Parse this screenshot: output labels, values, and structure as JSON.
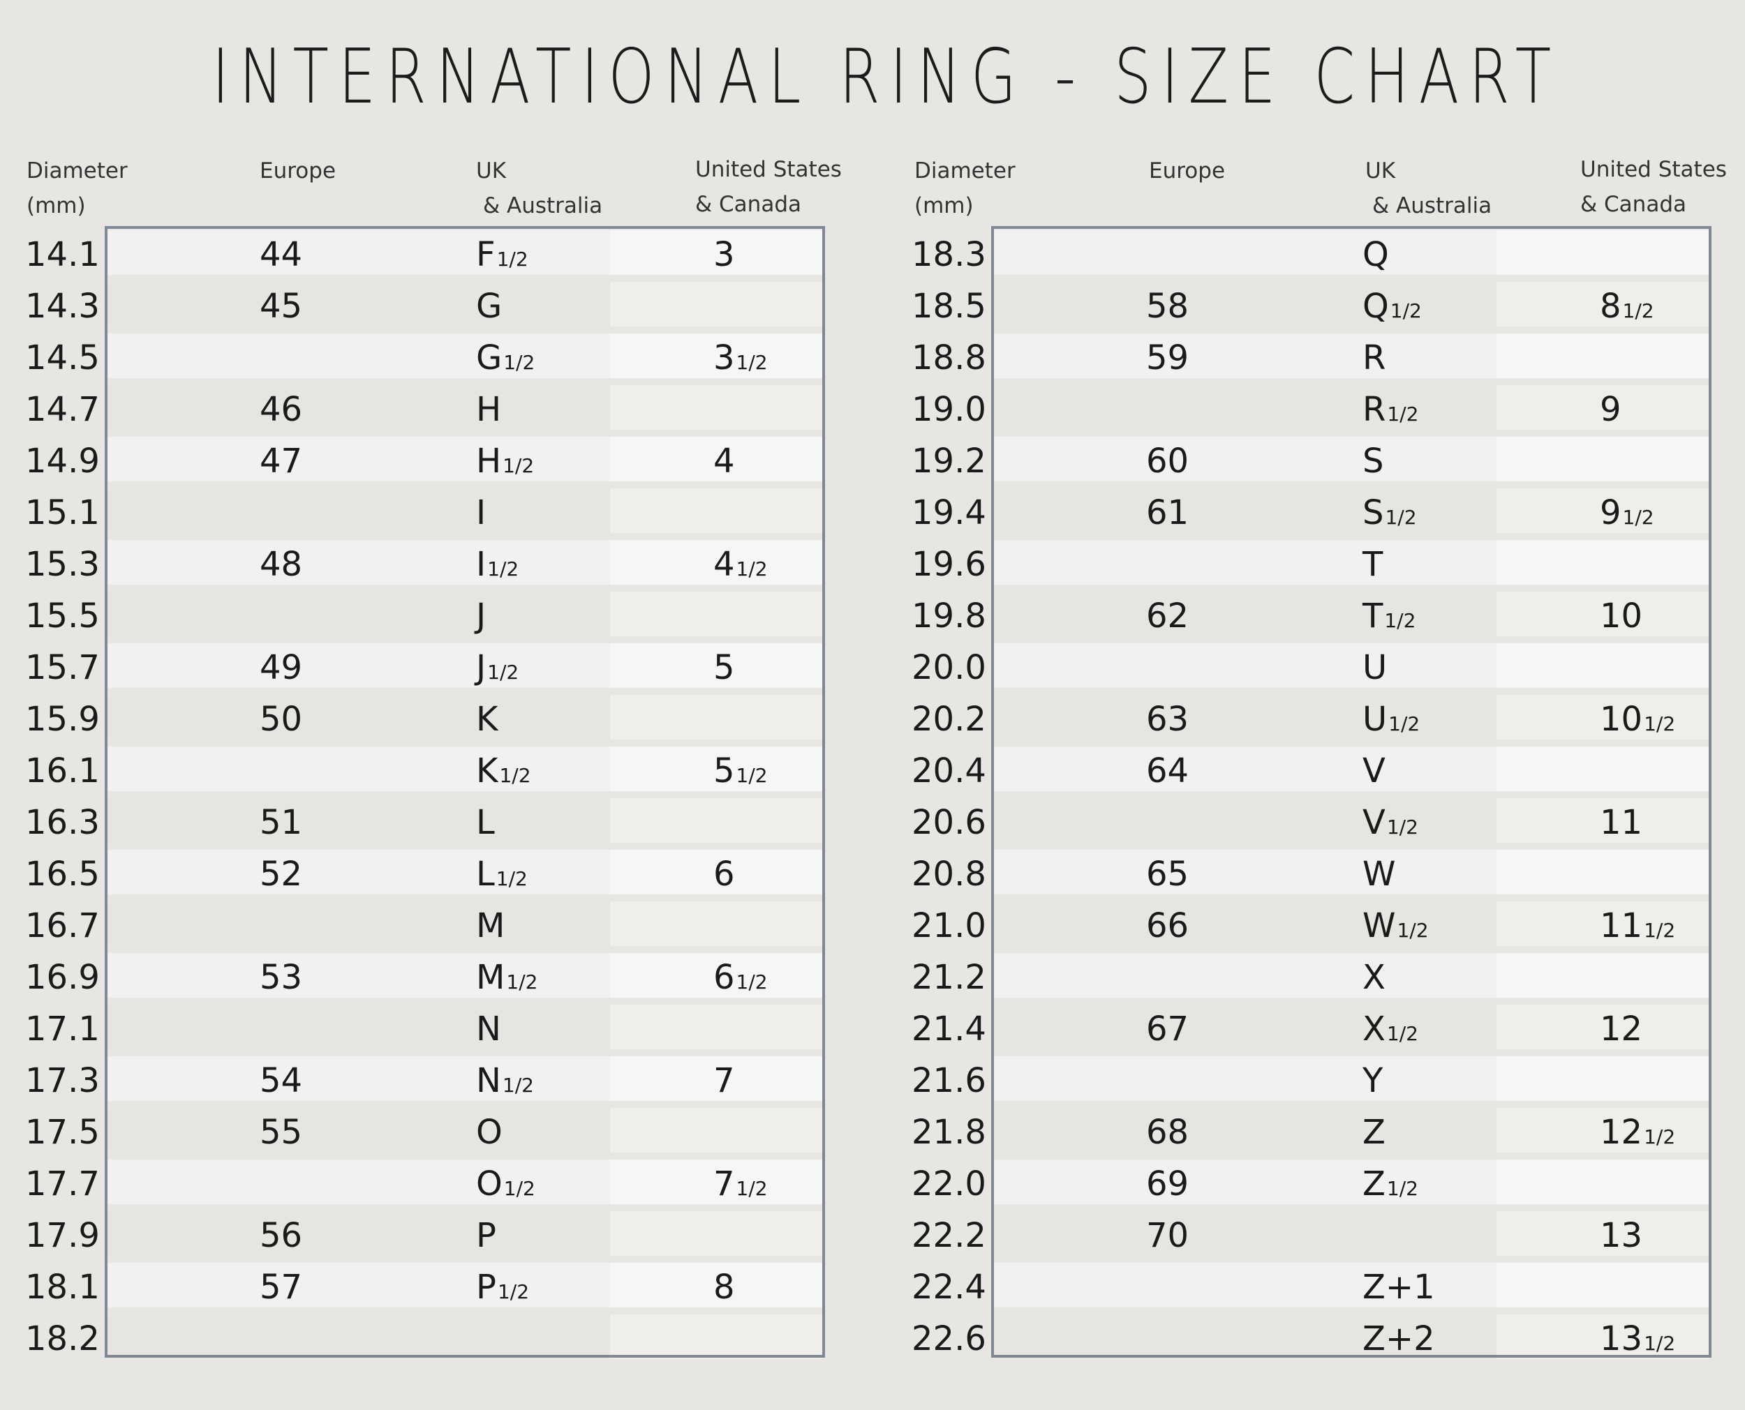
{
  "title": "INTERNATIONAL RING - SIZE CHART",
  "logo_icon": "lotus-icon",
  "colors": {
    "background": "#e7e6e2",
    "border": "#7f8894",
    "band_dark": "#e6e5e1",
    "band_light": "#f1f1f1"
  },
  "headers": {
    "diameter_line1": "Diameter",
    "diameter_line2": "(mm)",
    "europe": "Europe",
    "uk_line1": "UK",
    "uk_line2": "& Australia",
    "us_line1": "United States",
    "us_line2": "& Canada"
  },
  "left_table": [
    {
      "diameter": "14.1",
      "europe": "44",
      "uk": "F",
      "uk_half": "1/2",
      "us": "3",
      "us_half": ""
    },
    {
      "diameter": "14.3",
      "europe": "45",
      "uk": "G",
      "uk_half": "",
      "us": "",
      "us_half": ""
    },
    {
      "diameter": "14.5",
      "europe": "",
      "uk": "G",
      "uk_half": "1/2",
      "us": "3",
      "us_half": "1/2"
    },
    {
      "diameter": "14.7",
      "europe": "46",
      "uk": "H",
      "uk_half": "",
      "us": "",
      "us_half": ""
    },
    {
      "diameter": "14.9",
      "europe": "47",
      "uk": "H",
      "uk_half": "1/2",
      "us": "4",
      "us_half": ""
    },
    {
      "diameter": "15.1",
      "europe": "",
      "uk": "I",
      "uk_half": "",
      "us": "",
      "us_half": ""
    },
    {
      "diameter": "15.3",
      "europe": "48",
      "uk": "I",
      "uk_half": "1/2",
      "us": "4",
      "us_half": "1/2"
    },
    {
      "diameter": "15.5",
      "europe": "",
      "uk": "J",
      "uk_half": "",
      "us": "",
      "us_half": ""
    },
    {
      "diameter": "15.7",
      "europe": "49",
      "uk": "J",
      "uk_half": "1/2",
      "us": "5",
      "us_half": ""
    },
    {
      "diameter": "15.9",
      "europe": "50",
      "uk": "K",
      "uk_half": "",
      "us": "",
      "us_half": ""
    },
    {
      "diameter": "16.1",
      "europe": "",
      "uk": "K",
      "uk_half": "1/2",
      "us": "5",
      "us_half": "1/2"
    },
    {
      "diameter": "16.3",
      "europe": "51",
      "uk": "L",
      "uk_half": "",
      "us": "",
      "us_half": ""
    },
    {
      "diameter": "16.5",
      "europe": "52",
      "uk": "L",
      "uk_half": "1/2",
      "us": "6",
      "us_half": ""
    },
    {
      "diameter": "16.7",
      "europe": "",
      "uk": "M",
      "uk_half": "",
      "us": "",
      "us_half": ""
    },
    {
      "diameter": "16.9",
      "europe": "53",
      "uk": "M",
      "uk_half": "1/2",
      "us": "6",
      "us_half": "1/2"
    },
    {
      "diameter": "17.1",
      "europe": "",
      "uk": "N",
      "uk_half": "",
      "us": "",
      "us_half": ""
    },
    {
      "diameter": "17.3",
      "europe": "54",
      "uk": "N",
      "uk_half": "1/2",
      "us": "7",
      "us_half": ""
    },
    {
      "diameter": "17.5",
      "europe": "55",
      "uk": "O",
      "uk_half": "",
      "us": "",
      "us_half": ""
    },
    {
      "diameter": "17.7",
      "europe": "",
      "uk": "O",
      "uk_half": "1/2",
      "us": "7",
      "us_half": "1/2"
    },
    {
      "diameter": "17.9",
      "europe": "56",
      "uk": "P",
      "uk_half": "",
      "us": "",
      "us_half": ""
    },
    {
      "diameter": "18.1",
      "europe": "57",
      "uk": "P",
      "uk_half": "1/2",
      "us": "8",
      "us_half": ""
    },
    {
      "diameter": "18.2",
      "europe": "",
      "uk": "",
      "uk_half": "",
      "us": "",
      "us_half": ""
    }
  ],
  "right_table": [
    {
      "diameter": "18.3",
      "europe": "",
      "uk": "Q",
      "uk_half": "",
      "us": "",
      "us_half": ""
    },
    {
      "diameter": "18.5",
      "europe": "58",
      "uk": "Q",
      "uk_half": "1/2",
      "us": "8",
      "us_half": "1/2"
    },
    {
      "diameter": "18.8",
      "europe": "59",
      "uk": "R",
      "uk_half": "",
      "us": "",
      "us_half": ""
    },
    {
      "diameter": "19.0",
      "europe": "",
      "uk": "R",
      "uk_half": "1/2",
      "us": "9",
      "us_half": ""
    },
    {
      "diameter": "19.2",
      "europe": "60",
      "uk": "S",
      "uk_half": "",
      "us": "",
      "us_half": ""
    },
    {
      "diameter": "19.4",
      "europe": "61",
      "uk": "S",
      "uk_half": "1/2",
      "us": "9",
      "us_half": "1/2"
    },
    {
      "diameter": "19.6",
      "europe": "",
      "uk": "T",
      "uk_half": "",
      "us": "",
      "us_half": ""
    },
    {
      "diameter": "19.8",
      "europe": "62",
      "uk": "T",
      "uk_half": "1/2",
      "us": "10",
      "us_half": ""
    },
    {
      "diameter": "20.0",
      "europe": "",
      "uk": "U",
      "uk_half": "",
      "us": "",
      "us_half": ""
    },
    {
      "diameter": "20.2",
      "europe": "63",
      "uk": "U",
      "uk_half": "1/2",
      "us": "10",
      "us_half": "1/2"
    },
    {
      "diameter": "20.4",
      "europe": "64",
      "uk": "V",
      "uk_half": "",
      "us": "",
      "us_half": ""
    },
    {
      "diameter": "20.6",
      "europe": "",
      "uk": "V",
      "uk_half": "1/2",
      "us": "11",
      "us_half": ""
    },
    {
      "diameter": "20.8",
      "europe": "65",
      "uk": "W",
      "uk_half": "",
      "us": "",
      "us_half": ""
    },
    {
      "diameter": "21.0",
      "europe": "66",
      "uk": "W",
      "uk_half": "1/2",
      "us": "11",
      "us_half": "1/2"
    },
    {
      "diameter": "21.2",
      "europe": "",
      "uk": "X",
      "uk_half": "",
      "us": "",
      "us_half": ""
    },
    {
      "diameter": "21.4",
      "europe": "67",
      "uk": "X",
      "uk_half": "1/2",
      "us": "12",
      "us_half": ""
    },
    {
      "diameter": "21.6",
      "europe": "",
      "uk": "Y",
      "uk_half": "",
      "us": "",
      "us_half": ""
    },
    {
      "diameter": "21.8",
      "europe": "68",
      "uk": "Z",
      "uk_half": "",
      "us": "12",
      "us_half": "1/2"
    },
    {
      "diameter": "22.0",
      "europe": "69",
      "uk": "Z",
      "uk_half": "1/2",
      "us": "",
      "us_half": ""
    },
    {
      "diameter": "22.2",
      "europe": "70",
      "uk": "",
      "uk_half": "",
      "us": "13",
      "us_half": ""
    },
    {
      "diameter": "22.4",
      "europe": "",
      "uk": "Z+1",
      "uk_half": "",
      "us": "",
      "us_half": ""
    },
    {
      "diameter": "22.6",
      "europe": "",
      "uk": "Z+2",
      "uk_half": "",
      "us": "13",
      "us_half": "1/2"
    }
  ]
}
